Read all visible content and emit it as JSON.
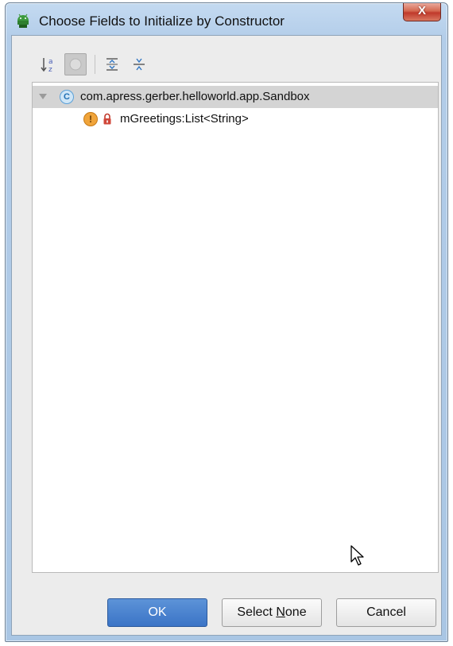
{
  "dialog": {
    "title": "Choose Fields to Initialize by Constructor",
    "close_label": "X"
  },
  "toolbar": {
    "buttons": [
      {
        "name": "sort-alphabetically-icon",
        "pressed": false
      },
      {
        "name": "show-classes-icon",
        "pressed": true
      },
      {
        "name": "expand-all-icon",
        "pressed": false
      },
      {
        "name": "collapse-all-icon",
        "pressed": false
      }
    ]
  },
  "tree": {
    "class_node": {
      "expander": "collapse-triangle-icon",
      "icon": "class-icon",
      "icon_letter": "C",
      "label": "com.apress.gerber.helloworld.app.Sandbox",
      "selected": true
    },
    "field_node": {
      "icons": [
        "field-warning-icon",
        "private-lock-icon"
      ],
      "warning_glyph": "!",
      "label": "mGreetings:List<String>"
    }
  },
  "buttons": {
    "ok": "OK",
    "select_none_prefix": "Select ",
    "select_none_mnemonic": "N",
    "select_none_suffix": "one",
    "cancel": "Cancel"
  },
  "colors": {
    "title_bar": "#b3cde9",
    "close_button": "#c0392b",
    "ok_button": "#3b74c6",
    "selected_row": "#d4d4d4"
  }
}
